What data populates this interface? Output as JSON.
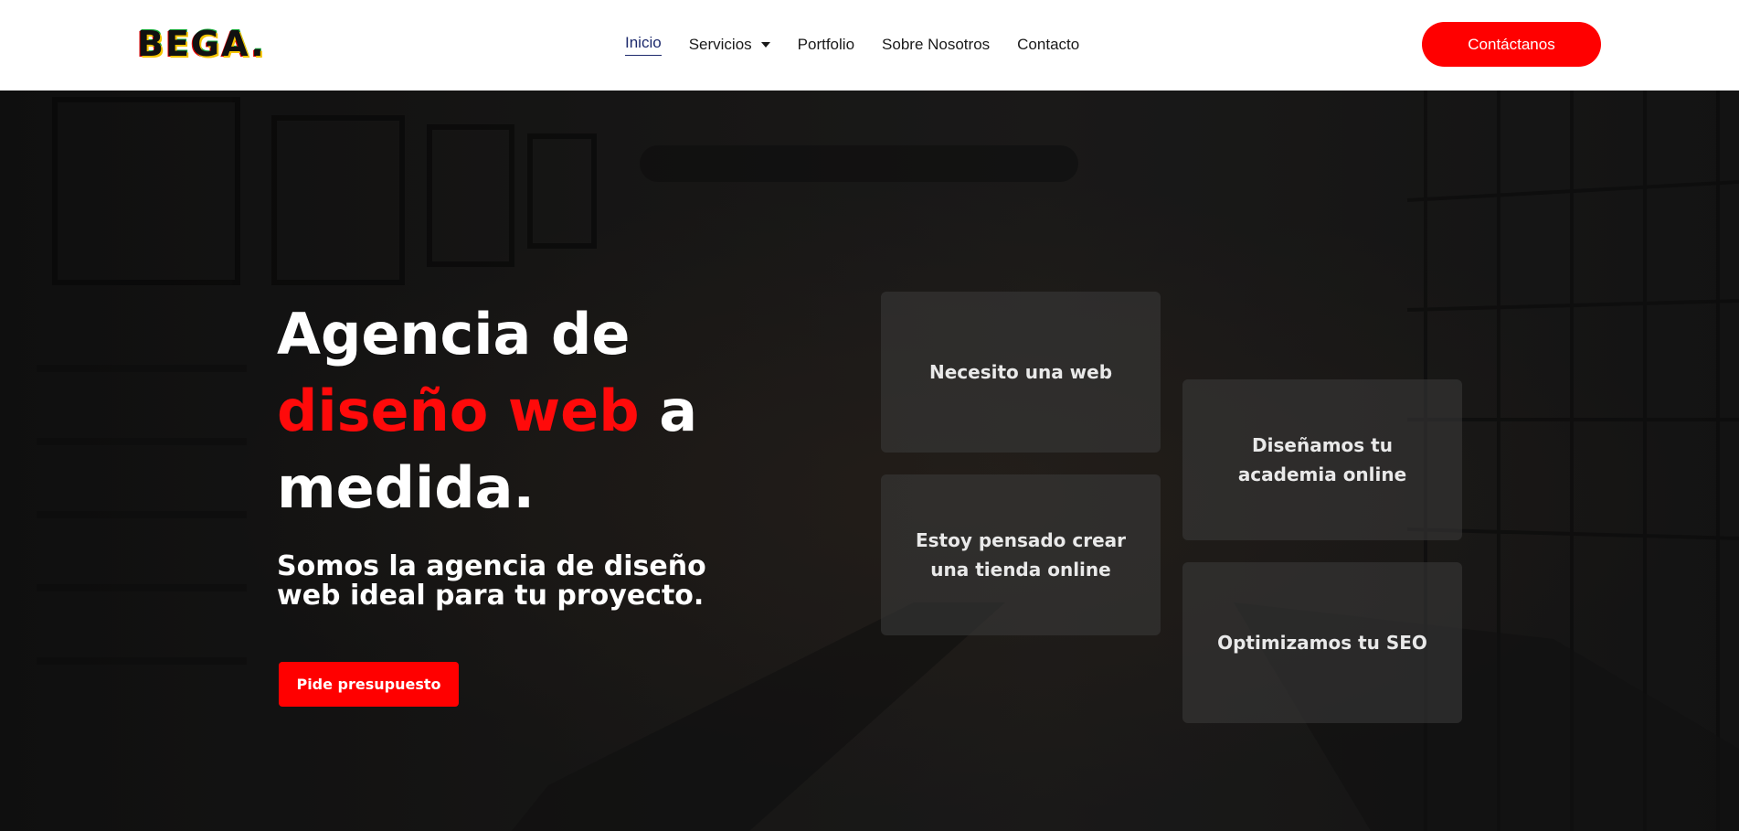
{
  "header": {
    "logo_text": "BEGA.",
    "nav": [
      {
        "label": "Inicio"
      },
      {
        "label": "Servicios"
      },
      {
        "label": "Portfolio"
      },
      {
        "label": "Sobre Nosotros"
      },
      {
        "label": "Contacto"
      }
    ],
    "cta_label": "Contáctanos"
  },
  "hero": {
    "title_part1": "Agencia de",
    "title_accent": "diseño web",
    "title_part2": " a medida.",
    "subtitle": "Somos la agencia de diseño web ideal para tu proyecto.",
    "cta_label": "Pide presupuesto",
    "cards": [
      {
        "label": "Necesito una web"
      },
      {
        "label": "Estoy pensado crear una tienda online"
      },
      {
        "label": "Diseñamos tu academia online"
      },
      {
        "label": "Optimizamos tu SEO"
      }
    ]
  },
  "colors": {
    "accent": "#ff0000",
    "nav_active": "#1d2a6d",
    "hero_bg": "#1e1d1c",
    "card_bg": "#3c3c3c"
  }
}
